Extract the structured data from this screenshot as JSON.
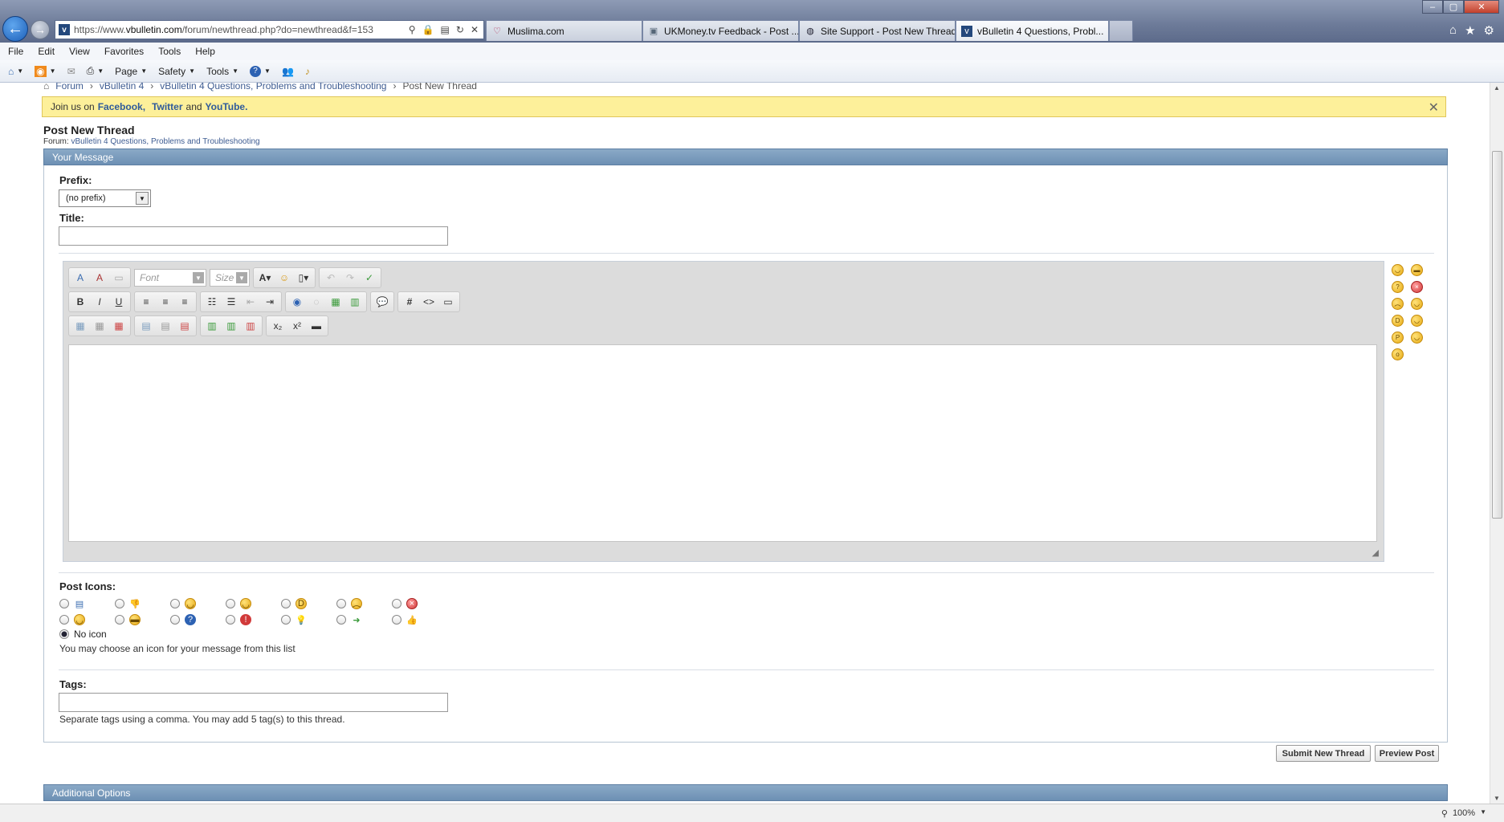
{
  "browser": {
    "url_prefix": "https://www.",
    "url_domain": "vbulletin.com",
    "url_path": "/forum/newthread.php?do=newthread&f=153",
    "site_icon": "vb-logo-icon",
    "tabs": [
      {
        "label": "Muslima.com",
        "icon": "heart-icon"
      },
      {
        "label": "UKMoney.tv Feedback - Post ...",
        "icon": "page-icon"
      },
      {
        "label": "Site Support - Post New Thread",
        "icon": "swirl-icon"
      },
      {
        "label": "vBulletin 4 Questions, Probl...",
        "icon": "vb-logo-icon",
        "close": "×"
      }
    ],
    "menu": [
      "File",
      "Edit",
      "View",
      "Favorites",
      "Tools",
      "Help"
    ],
    "commands": [
      "Page",
      "Safety",
      "Tools"
    ],
    "zoom": "100%"
  },
  "breadcrumb": [
    "Forum",
    "vBulletin 4",
    "vBulletin 4 Questions, Problems and Troubleshooting",
    "Post New Thread"
  ],
  "notice": {
    "prefix": "Join us on",
    "link1": "Facebook,",
    "link2": "Twitter",
    "and": "and",
    "link3": "YouTube.",
    "close": "✕"
  },
  "page": {
    "title": "Post New Thread",
    "forum_label": "Forum:",
    "forum_name": "vBulletin 4 Questions, Problems and Troubleshooting"
  },
  "form": {
    "section_title": "Your Message",
    "prefix_label": "Prefix:",
    "prefix_value": "(no prefix)",
    "title_label": "Title:",
    "editor": {
      "font_placeholder": "Font",
      "size_placeholder": "Size"
    },
    "post_icons_label": "Post Icons:",
    "no_icon_label": "No icon",
    "icon_hint": "You may choose an icon for your message from this list",
    "tags_label": "Tags:",
    "tags_hint": "Separate tags using a comma. You may add 5 tag(s) to this thread.",
    "submit_label": "Submit New Thread",
    "preview_label": "Preview Post",
    "additional_options": "Additional Options"
  },
  "colors": {
    "panel_header": "#7a9cbe",
    "notice_bg": "#fdf09a",
    "link": "#3e5c92"
  }
}
